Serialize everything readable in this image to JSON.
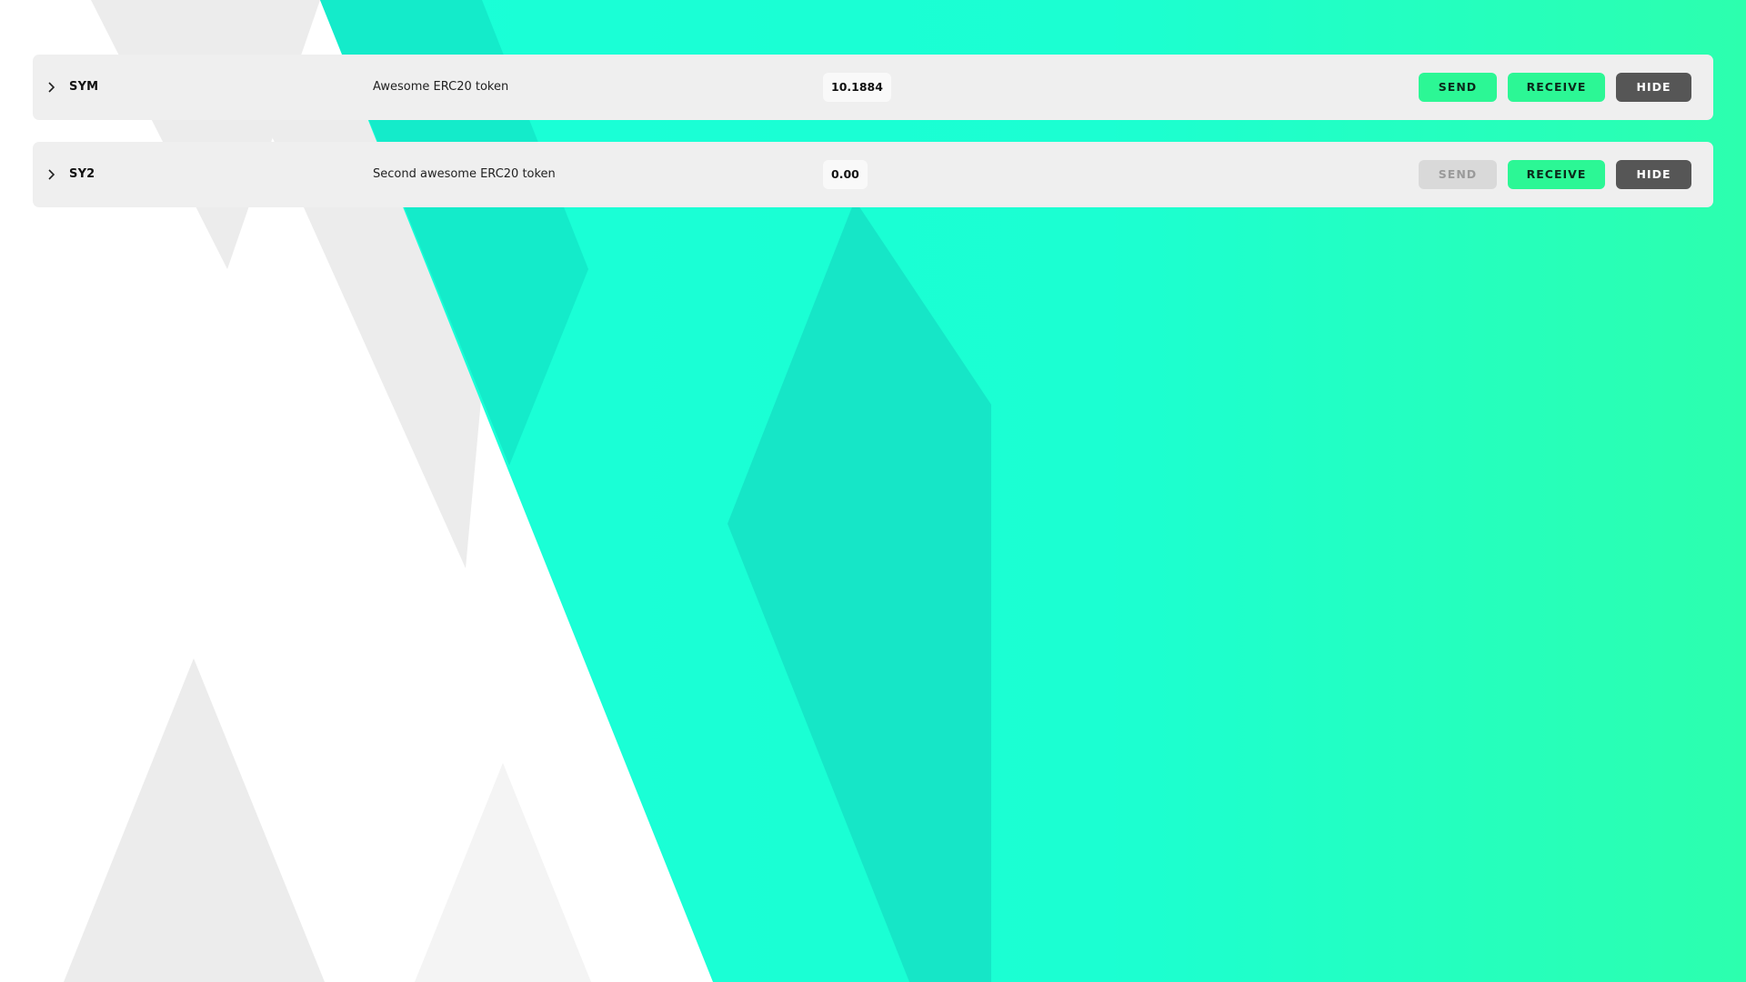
{
  "colors": {
    "accent": "#2cf795",
    "teal": "#19ffd8",
    "row_background": "#efefef",
    "hide_button": "#565656",
    "disabled_button": "#d9d9d9"
  },
  "icons": {
    "expand": "chevron-right-icon"
  },
  "tokens": [
    {
      "symbol": "SYM",
      "name": "Awesome ERC20 token",
      "balance": "10.1884",
      "send_label": "SEND",
      "send_enabled": true,
      "receive_label": "RECEIVE",
      "hide_label": "HIDE"
    },
    {
      "symbol": "SY2",
      "name": "Second awesome ERC20 token",
      "balance": "0.00",
      "send_label": "SEND",
      "send_enabled": false,
      "receive_label": "RECEIVE",
      "hide_label": "HIDE"
    }
  ]
}
